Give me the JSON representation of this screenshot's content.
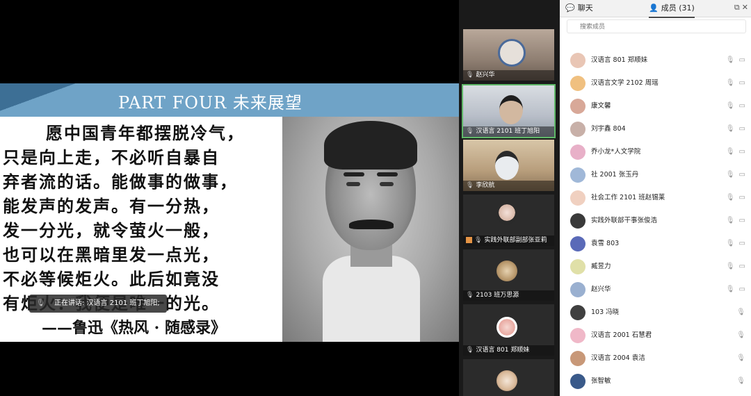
{
  "slide": {
    "title": "PART FOUR  未来展望",
    "lines": [
      "愿中国青年都摆脱冷气，",
      "只是向上走，不必听自暴自",
      "弃者流的话。能做事的做事，",
      "能发声的发声。有一分热，",
      "发一分光，就令萤火一般，",
      "也可以在黑暗里发一点光，",
      "不必等候炬火。此后如竟没",
      "有炬火：我便是唯一的光。"
    ],
    "attribution": "——鲁迅《热风 · 随感录》"
  },
  "speaking": {
    "label": "正在讲话: 汉语言 2101 班丁旭阳;"
  },
  "video_tiles": [
    {
      "name": "赵兴华"
    },
    {
      "name": "汉语言 2101 班丁旭阳"
    },
    {
      "name": "李欣航"
    },
    {
      "name": "实践外联部副部张亚莉"
    },
    {
      "name": "2103 班万思源"
    },
    {
      "name": "汉语言 801 郑顺妹"
    },
    {
      "name": ""
    }
  ],
  "panel": {
    "chat_tab": "聊天",
    "members_tab": "成员 (31)",
    "search_placeholder": "搜索成员",
    "members": [
      {
        "name": "汉语言 801 郑顺妹",
        "color": "#e9c6b5",
        "video_off": true
      },
      {
        "name": "汉语言文学 2102 周瑶",
        "color": "#f0c080",
        "video_off": true
      },
      {
        "name": "康文馨",
        "color": "#d8a898",
        "video_off": true
      },
      {
        "name": "刘宇鑫 804",
        "color": "#c8b0a8",
        "video_off": true
      },
      {
        "name": "乔小龙*人文学院",
        "color": "#e8b0c8",
        "video_off": true
      },
      {
        "name": "社 2001 张玉丹",
        "color": "#a0b8d8",
        "video_off": true
      },
      {
        "name": "社会工作 2101 班赵锡莱",
        "color": "#f0d0c0",
        "video_off": true
      },
      {
        "name": "实践外联部干事张俊浩",
        "color": "#3a3a3a",
        "video_off": true
      },
      {
        "name": "袁雪 803",
        "color": "#5a6ab8",
        "video_off": true
      },
      {
        "name": "臧昱力",
        "color": "#e0e0a8",
        "video_off": true
      },
      {
        "name": "赵兴华",
        "color": "#9ab0d0",
        "video_off": true
      },
      {
        "name": "103 冯晓",
        "color": "#404040",
        "video_off": false
      },
      {
        "name": "汉语言 2001 石慧君",
        "color": "#f0b8c8",
        "video_off": false
      },
      {
        "name": "汉语言 2004 袁洁",
        "color": "#c89878",
        "video_off": false
      },
      {
        "name": "张智敏",
        "color": "#3a5a8a",
        "video_off": false
      }
    ]
  }
}
